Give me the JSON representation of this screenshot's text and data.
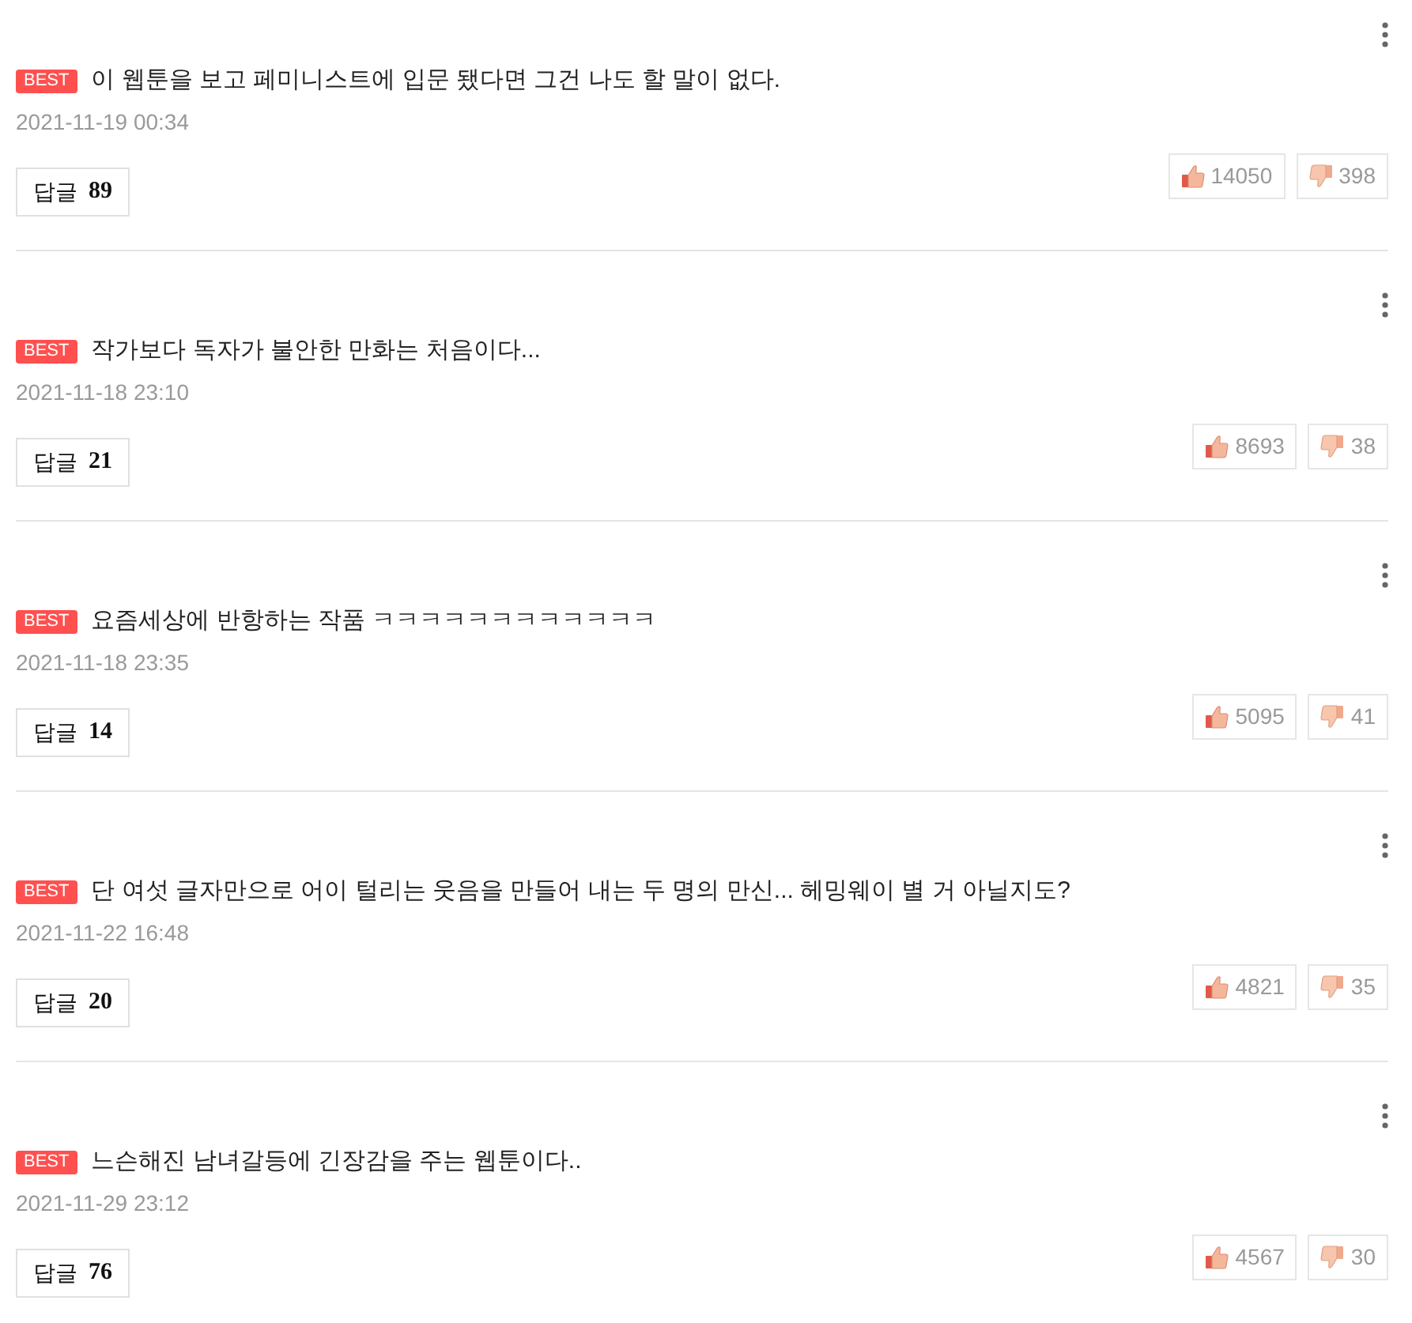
{
  "comments": [
    {
      "badge": "BEST",
      "text": "이 웹툰을 보고 페미니스트에 입문 됐다면 그건 나도 할 말이 없다.",
      "date": "2021-11-19 00:34",
      "reply": {
        "label": "답글",
        "count": "89"
      },
      "likes": "14050",
      "dislikes": "398"
    },
    {
      "badge": "BEST",
      "text": "작가보다 독자가 불안한 만화는 처음이다...",
      "date": "2021-11-18 23:10",
      "reply": {
        "label": "답글",
        "count": "21"
      },
      "likes": "8693",
      "dislikes": "38"
    },
    {
      "badge": "BEST",
      "text": "요즘세상에 반항하는 작품 ㅋㅋㅋㅋㅋㅋㅋㅋㅋㅋㅋㅋ",
      "date": "2021-11-18 23:35",
      "reply": {
        "label": "답글",
        "count": "14"
      },
      "likes": "5095",
      "dislikes": "41"
    },
    {
      "badge": "BEST",
      "text": "단 여섯 글자만으로 어이 털리는 웃음을 만들어 내는 두 명의 만신... 헤밍웨이 별 거 아닐지도?",
      "date": "2021-11-22 16:48",
      "reply": {
        "label": "답글",
        "count": "20"
      },
      "likes": "4821",
      "dislikes": "35"
    },
    {
      "badge": "BEST",
      "text": "느슨해진 남녀갈등에 긴장감을 주는 웹툰이다..",
      "date": "2021-11-29 23:12",
      "reply": {
        "label": "답글",
        "count": "76"
      },
      "likes": "4567",
      "dislikes": "30"
    }
  ]
}
